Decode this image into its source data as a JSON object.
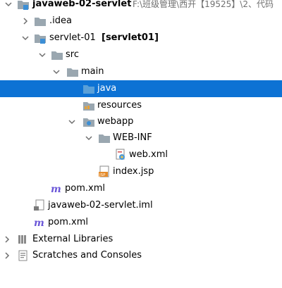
{
  "tree": {
    "root_name": "javaweb-02-servlet",
    "root_path": "F:\\班级管理\\西开【19525】\\2、代码",
    "idea": ".idea",
    "module_name": "servlet-01",
    "module_tag": "[servlet01]",
    "src": "src",
    "main": "main",
    "java": "java",
    "resources": "resources",
    "webapp": "webapp",
    "webinf": "WEB-INF",
    "webxml": "web.xml",
    "indexjsp": "index.jsp",
    "module_pom": "pom.xml",
    "iml": "javaweb-02-servlet.iml",
    "root_pom": "pom.xml",
    "external_libraries": "External Libraries",
    "scratches": "Scratches and Consoles"
  },
  "colors": {
    "selection": "#0d72d4",
    "folder": "#9aa7b0",
    "source_folder": "#5aa0d8",
    "maven": "#6b57d8"
  }
}
